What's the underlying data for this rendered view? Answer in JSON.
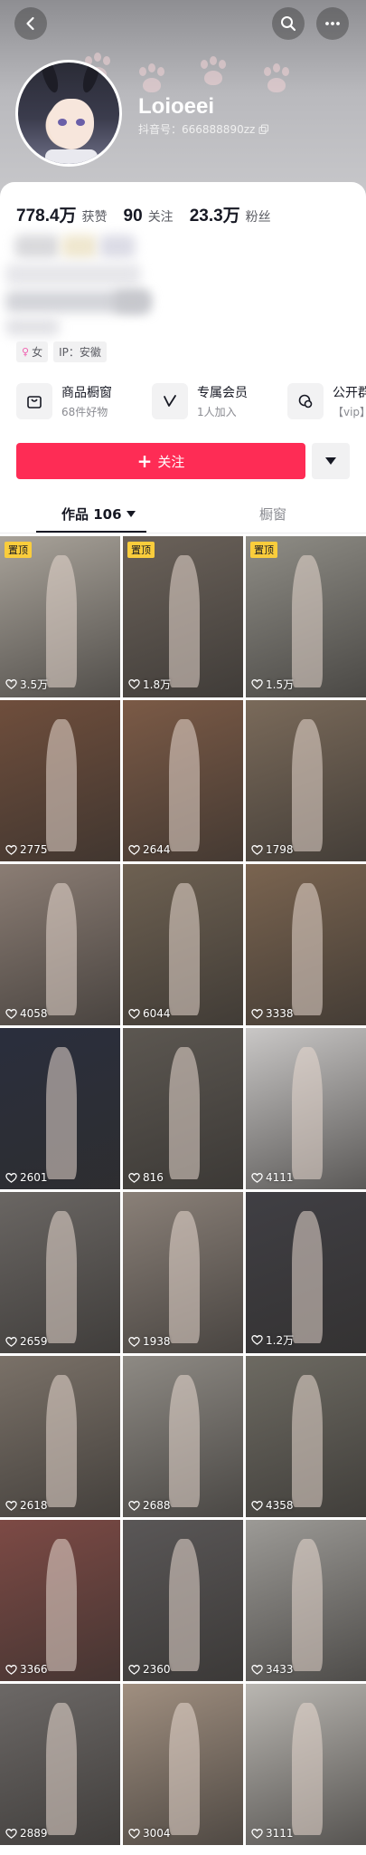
{
  "profile": {
    "nickname": "Loioeei",
    "douyin_id": "抖音号：666888890zz"
  },
  "stats": [
    {
      "value": "778.4万",
      "label": "获赞"
    },
    {
      "value": "90",
      "label": "关注"
    },
    {
      "value": "23.3万",
      "label": "粉丝"
    }
  ],
  "tags": {
    "gender": "女",
    "ip": "IP：安徽"
  },
  "shortcuts": [
    {
      "icon": "shop-bag-icon",
      "title": "商品橱窗",
      "subtitle": "68件好物"
    },
    {
      "icon": "vip-v-icon",
      "title": "专属会员",
      "subtitle": "1人加入"
    },
    {
      "icon": "chat-icon",
      "title": "公开群",
      "subtitle": "【vip】"
    }
  ],
  "actions": {
    "follow_label": "关注"
  },
  "tabs": {
    "works": "作品 106",
    "window": "橱窗"
  },
  "colors": {
    "accent": "#fe2c55",
    "pin_badge": "#facd3c"
  },
  "videos": [
    {
      "likes": "3.5万",
      "pinned": true,
      "pin_label": "置顶",
      "bg": "#a9a39a"
    },
    {
      "likes": "1.8万",
      "pinned": true,
      "pin_label": "置顶",
      "bg": "#6b625a"
    },
    {
      "likes": "1.5万",
      "pinned": true,
      "pin_label": "置顶",
      "bg": "#8f8d86"
    },
    {
      "likes": "2775",
      "bg": "#6f4e3c"
    },
    {
      "likes": "2644",
      "bg": "#7b5a46"
    },
    {
      "likes": "1798",
      "bg": "#7a6a5a"
    },
    {
      "likes": "4058",
      "bg": "#8b7d74"
    },
    {
      "likes": "6044",
      "bg": "#6e6152"
    },
    {
      "likes": "3338",
      "bg": "#7a6450"
    },
    {
      "likes": "2601",
      "bg": "#2a2e3d"
    },
    {
      "likes": "816",
      "bg": "#5c5751"
    },
    {
      "likes": "4111",
      "bg": "#c9c7c6"
    },
    {
      "likes": "2659",
      "bg": "#6a6663"
    },
    {
      "likes": "1938",
      "bg": "#8a8078"
    },
    {
      "likes": "1.2万",
      "bg": "#403f44"
    },
    {
      "likes": "2618",
      "bg": "#7a7168"
    },
    {
      "likes": "2688",
      "bg": "#8e8a84"
    },
    {
      "likes": "4358",
      "bg": "#6d6a62"
    },
    {
      "likes": "3366",
      "bg": "#7d4a45"
    },
    {
      "likes": "2360",
      "bg": "#5a5757"
    },
    {
      "likes": "3433",
      "bg": "#9c9a96"
    },
    {
      "likes": "2889",
      "bg": "#6c6866"
    },
    {
      "likes": "3004",
      "bg": "#a08f80"
    },
    {
      "likes": "3111",
      "bg": "#b9b6b1"
    }
  ]
}
